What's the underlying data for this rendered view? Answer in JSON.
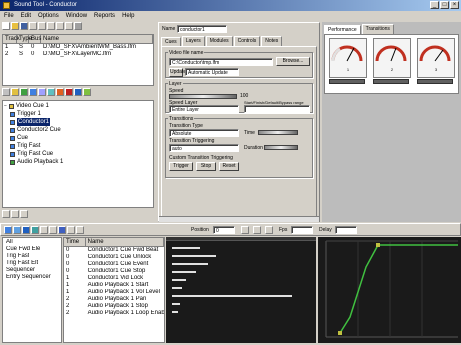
{
  "window": {
    "title": "Sound Tool - Conductor"
  },
  "menu": [
    "File",
    "Edit",
    "Options",
    "Window",
    "Reports",
    "Help"
  ],
  "files_table": {
    "headers": [
      "Track",
      "Type",
      "Bus",
      "Name"
    ],
    "rows": [
      {
        "track": "1",
        "type": "S",
        "bus": "0",
        "name": "D:\\MO_SFX\\AmbientWM_Bass.lfm"
      },
      {
        "track": "2",
        "type": "S",
        "bus": "0",
        "name": "D:\\MO_SFX\\LayerMC.lfm"
      }
    ]
  },
  "tree": {
    "root": "Video Cue 1",
    "items": [
      "Trigger 1",
      "Conductor1",
      "Conductor2 Cue",
      "Cue",
      "Trig Fast",
      "Trig Fast Cue",
      "Audio Playback 1"
    ]
  },
  "properties": {
    "name_label": "Name",
    "name_value": "conductor1",
    "tabs": [
      "Cues",
      "Layers",
      "Modules",
      "Controls",
      "Notes"
    ],
    "file_group": "Video file name",
    "file_path": "C:\\Conductor\\tmp.lfm",
    "browse": "Browse...",
    "update": "Update",
    "update_value": "Automatic Update",
    "layer_group": "Layer",
    "speed_label": "Speed",
    "speed_value": "100",
    "speed_layer_label": "Speed Layer",
    "speed_layer_value": "Entire Layer",
    "time_label": "Start/Finish/Default/Bypass range",
    "transitions_group": "Transitions",
    "transition_type_label": "Transition Type",
    "transition_type_value": "Absolute",
    "time_word": "Time",
    "transition_triggering_label": "Transition Triggering",
    "transition_triggering_value": "auto",
    "duration_word": "Duration",
    "custom_group": "Custom Transition Triggering",
    "buttons": [
      "Trigger",
      "Stop",
      "Reset"
    ]
  },
  "right_tabs": [
    "Performance",
    "Transitions"
  ],
  "gauges": [
    {
      "label": "1"
    },
    {
      "label": "2"
    },
    {
      "label": "3"
    }
  ],
  "timeline_toolbar": {
    "position_label": "Position",
    "position_value": "0",
    "fps_label": "Fps",
    "delay_label": "Delay"
  },
  "cue_list": [
    "All",
    "Cue Fwd Ele",
    "Trig Fast",
    "Trig Fast Elt",
    "Sequencer",
    "Entry Sequencer"
  ],
  "events": {
    "headers": [
      "Time",
      "Name"
    ],
    "rows": [
      {
        "time": "0",
        "name": "Conductor1 Cue Fwd Beat"
      },
      {
        "time": "0",
        "name": "Conductor1 Cue Unlock"
      },
      {
        "time": "0",
        "name": "Conductor1 Cue Event"
      },
      {
        "time": "0",
        "name": "Conductor1 Cue Stop"
      },
      {
        "time": "1",
        "name": "Conductor1 Vid Lock"
      },
      {
        "time": "1",
        "name": "Audio Playback 1 Start"
      },
      {
        "time": "1",
        "name": "Audio Playback 1 Vol Level"
      },
      {
        "time": "2",
        "name": "Audio Playback 1 Pan"
      },
      {
        "time": "2",
        "name": "Audio Playback 1 Stop"
      },
      {
        "time": "2",
        "name": "Audio Playback 1 Loop Enabled"
      }
    ]
  }
}
